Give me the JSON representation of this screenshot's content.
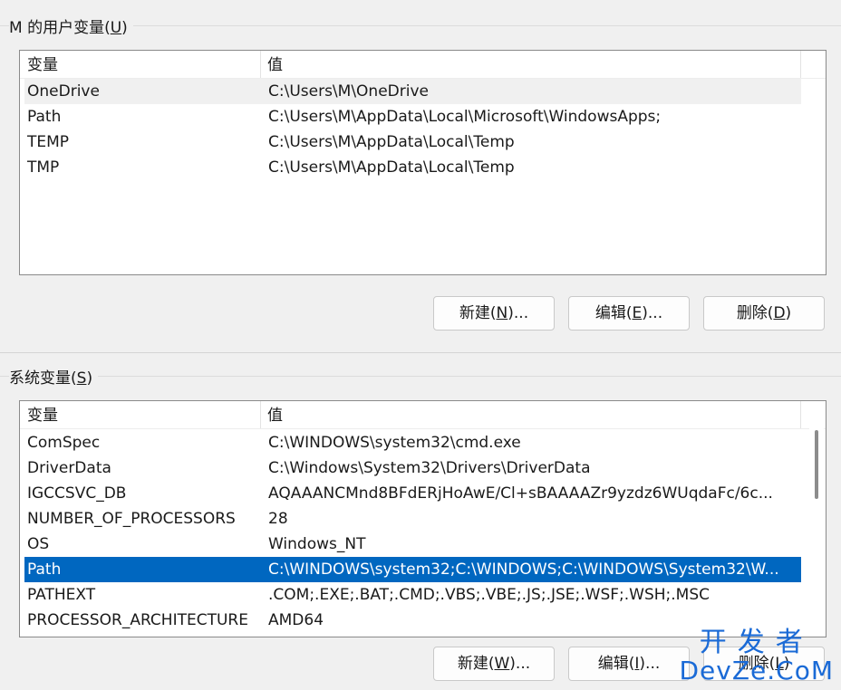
{
  "user_vars": {
    "title": "M 的用户变量(",
    "title_key": "U",
    "title_end": ")",
    "header_name": "变量",
    "header_value": "值",
    "rows": [
      {
        "name": "OneDrive",
        "value": "C:\\Users\\M\\OneDrive"
      },
      {
        "name": "Path",
        "value": "C:\\Users\\M\\AppData\\Local\\Microsoft\\WindowsApps;"
      },
      {
        "name": "TEMP",
        "value": "C:\\Users\\M\\AppData\\Local\\Temp"
      },
      {
        "name": "TMP",
        "value": "C:\\Users\\M\\AppData\\Local\\Temp"
      }
    ],
    "buttons": {
      "new": {
        "pre": "新建(",
        "key": "N",
        "post": ")..."
      },
      "edit": {
        "pre": "编辑(",
        "key": "E",
        "post": ")..."
      },
      "delete": {
        "pre": "删除(",
        "key": "D",
        "post": ")"
      }
    }
  },
  "system_vars": {
    "title": "系统变量(",
    "title_key": "S",
    "title_end": ")",
    "header_name": "变量",
    "header_value": "值",
    "rows": [
      {
        "name": "ComSpec",
        "value": "C:\\WINDOWS\\system32\\cmd.exe"
      },
      {
        "name": "DriverData",
        "value": "C:\\Windows\\System32\\Drivers\\DriverData"
      },
      {
        "name": "IGCCSVC_DB",
        "value": "AQAAANCMnd8BFdERjHoAwE/Cl+sBAAAAZr9yzdz6WUqdaFc/6c..."
      },
      {
        "name": "NUMBER_OF_PROCESSORS",
        "value": "28"
      },
      {
        "name": "OS",
        "value": "Windows_NT"
      },
      {
        "name": "Path",
        "value": "C:\\WINDOWS\\system32;C:\\WINDOWS;C:\\WINDOWS\\System32\\W..."
      },
      {
        "name": "PATHEXT",
        "value": ".COM;.EXE;.BAT;.CMD;.VBS;.VBE;.JS;.JSE;.WSF;.WSH;.MSC"
      },
      {
        "name": "PROCESSOR_ARCHITECTURE",
        "value": "AMD64"
      }
    ],
    "buttons": {
      "new": {
        "pre": "新建(",
        "key": "W",
        "post": ")..."
      },
      "edit": {
        "pre": "编辑(",
        "key": "I",
        "post": ")..."
      },
      "delete": {
        "pre": "删除(",
        "key": "L",
        "post": ")"
      }
    }
  },
  "watermark": {
    "top": "开发者",
    "bottom": "DevZe.CoM"
  },
  "colors": {
    "selection": "#0067c0",
    "watermark": "#1a6ad6"
  }
}
